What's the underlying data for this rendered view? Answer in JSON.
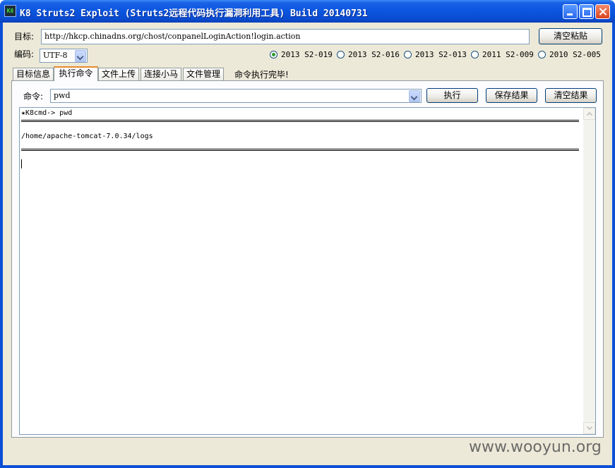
{
  "window": {
    "title": "K8 Struts2 Exploit (Struts2远程代码执行漏洞利用工具)  Build 20140731",
    "icon_text": "K8"
  },
  "target": {
    "label": "目标:",
    "url": "http://hkcp.chinadns.org/chost/conpanelLoginAction!login.action",
    "clear_paste_button": "清空粘贴"
  },
  "encoding": {
    "label": "编码:",
    "value": "UTF-8"
  },
  "exploits": [
    {
      "label": "2013 S2-019",
      "selected": true
    },
    {
      "label": "2013 S2-016",
      "selected": false
    },
    {
      "label": "2013 S2-013",
      "selected": false
    },
    {
      "label": "2011 S2-009",
      "selected": false
    },
    {
      "label": "2010 S2-005",
      "selected": false
    }
  ],
  "tabs": [
    {
      "label": "目标信息",
      "active": false
    },
    {
      "label": "执行命令",
      "active": true
    },
    {
      "label": "文件上传",
      "active": false
    },
    {
      "label": "连接小马",
      "active": false
    },
    {
      "label": "文件管理",
      "active": false
    }
  ],
  "status": "命令执行完毕!",
  "command": {
    "label": "命令:",
    "value": "pwd",
    "execute_button": "执行",
    "save_button": "保存结果",
    "clear_button": "清空结果"
  },
  "output": {
    "prompt_line": "★K8cmd-> pwd",
    "result_line": "/home/apache-tomcat-7.0.34/logs"
  },
  "watermark": "www.wooyun.org",
  "colors": {
    "titlebar": "#0b55e0",
    "window_face": "#ece9d8",
    "active_tab_accent": "#e68b2c",
    "radio_selected": "#2c9b2c"
  }
}
